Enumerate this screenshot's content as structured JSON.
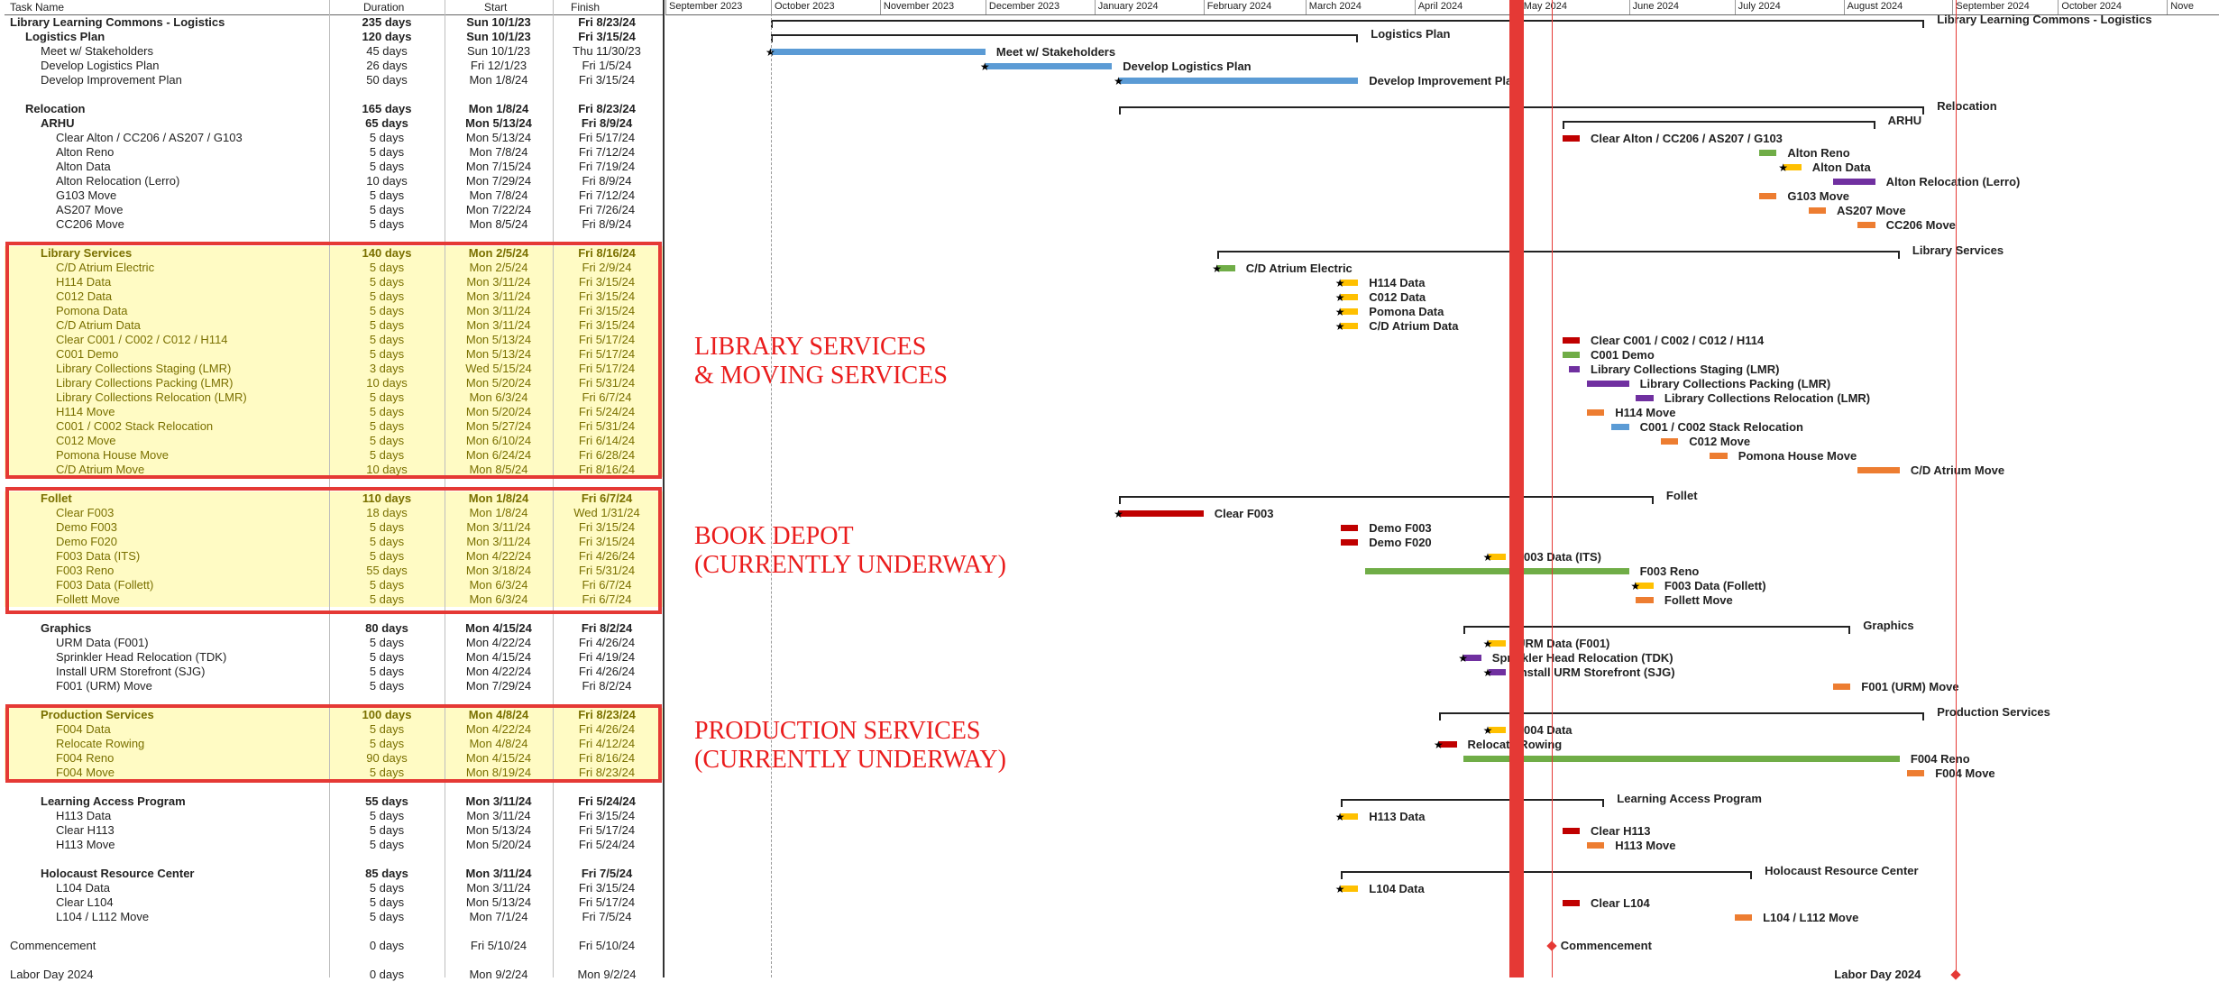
{
  "columns": {
    "task": "Task Name",
    "duration": "Duration",
    "start": "Start",
    "finish": "Finish"
  },
  "months": [
    "September 2023",
    "October 2023",
    "November 2023",
    "December 2023",
    "January 2024",
    "February 2024",
    "March 2024",
    "April 2024",
    "May 2024",
    "June 2024",
    "July 2024",
    "August 2024",
    "September 2024",
    "October 2024",
    "Nove"
  ],
  "rows": [
    {
      "name": "Library Learning Commons - Logistics",
      "duration": "235 days",
      "start": "Sun 10/1/23",
      "finish": "Fri 8/23/24",
      "indent": 0,
      "summary": true
    },
    {
      "name": "Logistics Plan",
      "duration": "120 days",
      "start": "Sun 10/1/23",
      "finish": "Fri 3/15/24",
      "indent": 1,
      "summary": true
    },
    {
      "name": "Meet w/ Stakeholders",
      "duration": "45 days",
      "start": "Sun 10/1/23",
      "finish": "Thu 11/30/23",
      "indent": 2
    },
    {
      "name": "Develop Logistics Plan",
      "duration": "26 days",
      "start": "Fri 12/1/23",
      "finish": "Fri 1/5/24",
      "indent": 2
    },
    {
      "name": "Develop Improvement Plan",
      "duration": "50 days",
      "start": "Mon 1/8/24",
      "finish": "Fri 3/15/24",
      "indent": 2
    },
    {
      "name": "",
      "duration": "",
      "start": "",
      "finish": "",
      "indent": 0
    },
    {
      "name": "Relocation",
      "duration": "165 days",
      "start": "Mon 1/8/24",
      "finish": "Fri 8/23/24",
      "indent": 1,
      "summary": true
    },
    {
      "name": "ARHU",
      "duration": "65 days",
      "start": "Mon 5/13/24",
      "finish": "Fri 8/9/24",
      "indent": 2,
      "summary": true
    },
    {
      "name": "Clear Alton / CC206 / AS207 / G103",
      "duration": "5 days",
      "start": "Mon 5/13/24",
      "finish": "Fri 5/17/24",
      "indent": 3
    },
    {
      "name": "Alton Reno",
      "duration": "5 days",
      "start": "Mon 7/8/24",
      "finish": "Fri 7/12/24",
      "indent": 3
    },
    {
      "name": "Alton Data",
      "duration": "5 days",
      "start": "Mon 7/15/24",
      "finish": "Fri 7/19/24",
      "indent": 3
    },
    {
      "name": "Alton Relocation (Lerro)",
      "duration": "10 days",
      "start": "Mon 7/29/24",
      "finish": "Fri 8/9/24",
      "indent": 3
    },
    {
      "name": "G103 Move",
      "duration": "5 days",
      "start": "Mon 7/8/24",
      "finish": "Fri 7/12/24",
      "indent": 3
    },
    {
      "name": "AS207 Move",
      "duration": "5 days",
      "start": "Mon 7/22/24",
      "finish": "Fri 7/26/24",
      "indent": 3
    },
    {
      "name": "CC206 Move",
      "duration": "5 days",
      "start": "Mon 8/5/24",
      "finish": "Fri 8/9/24",
      "indent": 3
    },
    {
      "name": "",
      "duration": "",
      "start": "",
      "finish": "",
      "indent": 0
    },
    {
      "name": "Library Services",
      "duration": "140 days",
      "start": "Mon 2/5/24",
      "finish": "Fri 8/16/24",
      "indent": 2,
      "summary": true,
      "hl": true
    },
    {
      "name": "C/D Atrium Electric",
      "duration": "5 days",
      "start": "Mon 2/5/24",
      "finish": "Fri 2/9/24",
      "indent": 3,
      "hl": true
    },
    {
      "name": "H114 Data",
      "duration": "5 days",
      "start": "Mon 3/11/24",
      "finish": "Fri 3/15/24",
      "indent": 3,
      "hl": true
    },
    {
      "name": "C012 Data",
      "duration": "5 days",
      "start": "Mon 3/11/24",
      "finish": "Fri 3/15/24",
      "indent": 3,
      "hl": true
    },
    {
      "name": "Pomona Data",
      "duration": "5 days",
      "start": "Mon 3/11/24",
      "finish": "Fri 3/15/24",
      "indent": 3,
      "hl": true
    },
    {
      "name": "C/D Atrium Data",
      "duration": "5 days",
      "start": "Mon 3/11/24",
      "finish": "Fri 3/15/24",
      "indent": 3,
      "hl": true
    },
    {
      "name": "Clear C001 / C002 / C012 / H114",
      "duration": "5 days",
      "start": "Mon 5/13/24",
      "finish": "Fri 5/17/24",
      "indent": 3,
      "hl": true
    },
    {
      "name": "C001 Demo",
      "duration": "5 days",
      "start": "Mon 5/13/24",
      "finish": "Fri 5/17/24",
      "indent": 3,
      "hl": true
    },
    {
      "name": "Library Collections Staging (LMR)",
      "duration": "3 days",
      "start": "Wed 5/15/24",
      "finish": "Fri 5/17/24",
      "indent": 3,
      "hl": true
    },
    {
      "name": "Library Collections Packing (LMR)",
      "duration": "10 days",
      "start": "Mon 5/20/24",
      "finish": "Fri 5/31/24",
      "indent": 3,
      "hl": true
    },
    {
      "name": "Library Collections Relocation (LMR)",
      "duration": "5 days",
      "start": "Mon 6/3/24",
      "finish": "Fri 6/7/24",
      "indent": 3,
      "hl": true
    },
    {
      "name": "H114 Move",
      "duration": "5 days",
      "start": "Mon 5/20/24",
      "finish": "Fri 5/24/24",
      "indent": 3,
      "hl": true
    },
    {
      "name": "C001 / C002 Stack Relocation",
      "duration": "5 days",
      "start": "Mon 5/27/24",
      "finish": "Fri 5/31/24",
      "indent": 3,
      "hl": true
    },
    {
      "name": "C012 Move",
      "duration": "5 days",
      "start": "Mon 6/10/24",
      "finish": "Fri 6/14/24",
      "indent": 3,
      "hl": true
    },
    {
      "name": "Pomona House Move",
      "duration": "5 days",
      "start": "Mon 6/24/24",
      "finish": "Fri 6/28/24",
      "indent": 3,
      "hl": true
    },
    {
      "name": "C/D Atrium Move",
      "duration": "10 days",
      "start": "Mon 8/5/24",
      "finish": "Fri 8/16/24",
      "indent": 3,
      "hl": true
    },
    {
      "name": "",
      "duration": "",
      "start": "",
      "finish": "",
      "indent": 0
    },
    {
      "name": "Follet",
      "duration": "110 days",
      "start": "Mon 1/8/24",
      "finish": "Fri 6/7/24",
      "indent": 2,
      "summary": true,
      "hl": true
    },
    {
      "name": "Clear F003",
      "duration": "18 days",
      "start": "Mon 1/8/24",
      "finish": "Wed 1/31/24",
      "indent": 3,
      "hl": true
    },
    {
      "name": "Demo F003",
      "duration": "5 days",
      "start": "Mon 3/11/24",
      "finish": "Fri 3/15/24",
      "indent": 3,
      "hl": true
    },
    {
      "name": "Demo F020",
      "duration": "5 days",
      "start": "Mon 3/11/24",
      "finish": "Fri 3/15/24",
      "indent": 3,
      "hl": true
    },
    {
      "name": "F003 Data (ITS)",
      "duration": "5 days",
      "start": "Mon 4/22/24",
      "finish": "Fri 4/26/24",
      "indent": 3,
      "hl": true
    },
    {
      "name": "F003 Reno",
      "duration": "55 days",
      "start": "Mon 3/18/24",
      "finish": "Fri 5/31/24",
      "indent": 3,
      "hl": true
    },
    {
      "name": "F003 Data (Follett)",
      "duration": "5 days",
      "start": "Mon 6/3/24",
      "finish": "Fri 6/7/24",
      "indent": 3,
      "hl": true
    },
    {
      "name": "Follett Move",
      "duration": "5 days",
      "start": "Mon 6/3/24",
      "finish": "Fri 6/7/24",
      "indent": 3,
      "hl": true
    },
    {
      "name": "",
      "duration": "",
      "start": "",
      "finish": "",
      "indent": 0
    },
    {
      "name": "Graphics",
      "duration": "80 days",
      "start": "Mon 4/15/24",
      "finish": "Fri 8/2/24",
      "indent": 2,
      "summary": true
    },
    {
      "name": "URM Data (F001)",
      "duration": "5 days",
      "start": "Mon 4/22/24",
      "finish": "Fri 4/26/24",
      "indent": 3
    },
    {
      "name": "Sprinkler Head Relocation (TDK)",
      "duration": "5 days",
      "start": "Mon 4/15/24",
      "finish": "Fri 4/19/24",
      "indent": 3
    },
    {
      "name": "Install URM Storefront (SJG)",
      "duration": "5 days",
      "start": "Mon 4/22/24",
      "finish": "Fri 4/26/24",
      "indent": 3
    },
    {
      "name": "F001 (URM) Move",
      "duration": "5 days",
      "start": "Mon 7/29/24",
      "finish": "Fri 8/2/24",
      "indent": 3
    },
    {
      "name": "",
      "duration": "",
      "start": "",
      "finish": "",
      "indent": 0
    },
    {
      "name": "Production Services",
      "duration": "100 days",
      "start": "Mon 4/8/24",
      "finish": "Fri 8/23/24",
      "indent": 2,
      "summary": true,
      "hl": true
    },
    {
      "name": "F004 Data",
      "duration": "5 days",
      "start": "Mon 4/22/24",
      "finish": "Fri 4/26/24",
      "indent": 3,
      "hl": true
    },
    {
      "name": "Relocate Rowing",
      "duration": "5 days",
      "start": "Mon 4/8/24",
      "finish": "Fri 4/12/24",
      "indent": 3,
      "hl": true
    },
    {
      "name": "F004 Reno",
      "duration": "90 days",
      "start": "Mon 4/15/24",
      "finish": "Fri 8/16/24",
      "indent": 3,
      "hl": true
    },
    {
      "name": "F004  Move",
      "duration": "5 days",
      "start": "Mon 8/19/24",
      "finish": "Fri 8/23/24",
      "indent": 3,
      "hl": true
    },
    {
      "name": "",
      "duration": "",
      "start": "",
      "finish": "",
      "indent": 0
    },
    {
      "name": "Learning Access Program",
      "duration": "55 days",
      "start": "Mon 3/11/24",
      "finish": "Fri 5/24/24",
      "indent": 2,
      "summary": true
    },
    {
      "name": "H113 Data",
      "duration": "5 days",
      "start": "Mon 3/11/24",
      "finish": "Fri 3/15/24",
      "indent": 3
    },
    {
      "name": "Clear H113",
      "duration": "5 days",
      "start": "Mon 5/13/24",
      "finish": "Fri 5/17/24",
      "indent": 3
    },
    {
      "name": "H113  Move",
      "duration": "5 days",
      "start": "Mon 5/20/24",
      "finish": "Fri 5/24/24",
      "indent": 3
    },
    {
      "name": "",
      "duration": "",
      "start": "",
      "finish": "",
      "indent": 0
    },
    {
      "name": "Holocaust Resource Center",
      "duration": "85 days",
      "start": "Mon 3/11/24",
      "finish": "Fri 7/5/24",
      "indent": 2,
      "summary": true
    },
    {
      "name": "L104 Data",
      "duration": "5 days",
      "start": "Mon 3/11/24",
      "finish": "Fri 3/15/24",
      "indent": 3
    },
    {
      "name": "Clear L104",
      "duration": "5 days",
      "start": "Mon 5/13/24",
      "finish": "Fri 5/17/24",
      "indent": 3
    },
    {
      "name": "L104 / L112 Move",
      "duration": "5 days",
      "start": "Mon 7/1/24",
      "finish": "Fri 7/5/24",
      "indent": 3
    },
    {
      "name": "",
      "duration": "",
      "start": "",
      "finish": "",
      "indent": 0
    },
    {
      "name": "Commencement",
      "duration": "0 days",
      "start": "Fri 5/10/24",
      "finish": "Fri 5/10/24",
      "indent": 0
    },
    {
      "name": "",
      "duration": "",
      "start": "",
      "finish": "",
      "indent": 0
    },
    {
      "name": "Labor Day 2024",
      "duration": "0 days",
      "start": "Mon 9/2/24",
      "finish": "Mon 9/2/24",
      "indent": 0
    }
  ],
  "annotations": [
    {
      "line1": "LIBRARY SERVICES",
      "line2": "& MOVING SERVICES"
    },
    {
      "line1": "BOOK DEPOT",
      "line2": "(CURRENTLY UNDERWAY)"
    },
    {
      "line1": "PRODUCTION SERVICES",
      "line2": "(CURRENTLY UNDERWAY)"
    }
  ],
  "bar_labels": {
    "title_summary": "Library Learning Commons - Logistics",
    "logistics_plan": "Logistics Plan",
    "relocation": "Relocation",
    "arhu": "ARHU",
    "library_services": "Library Services",
    "follet": "Follet",
    "graphics": "Graphics",
    "production_services": "Production Services",
    "learning_access": "Learning Access Program",
    "holocaust": "Holocaust Resource Center"
  },
  "colors": {
    "accent_red": "#e53935",
    "blue": "#5b9bd5",
    "green": "#70ad47",
    "yellow": "#ffc000",
    "orange": "#ed7d31",
    "purple": "#7030a0",
    "darkred": "#c00000",
    "highlight": "#fffbc4"
  }
}
